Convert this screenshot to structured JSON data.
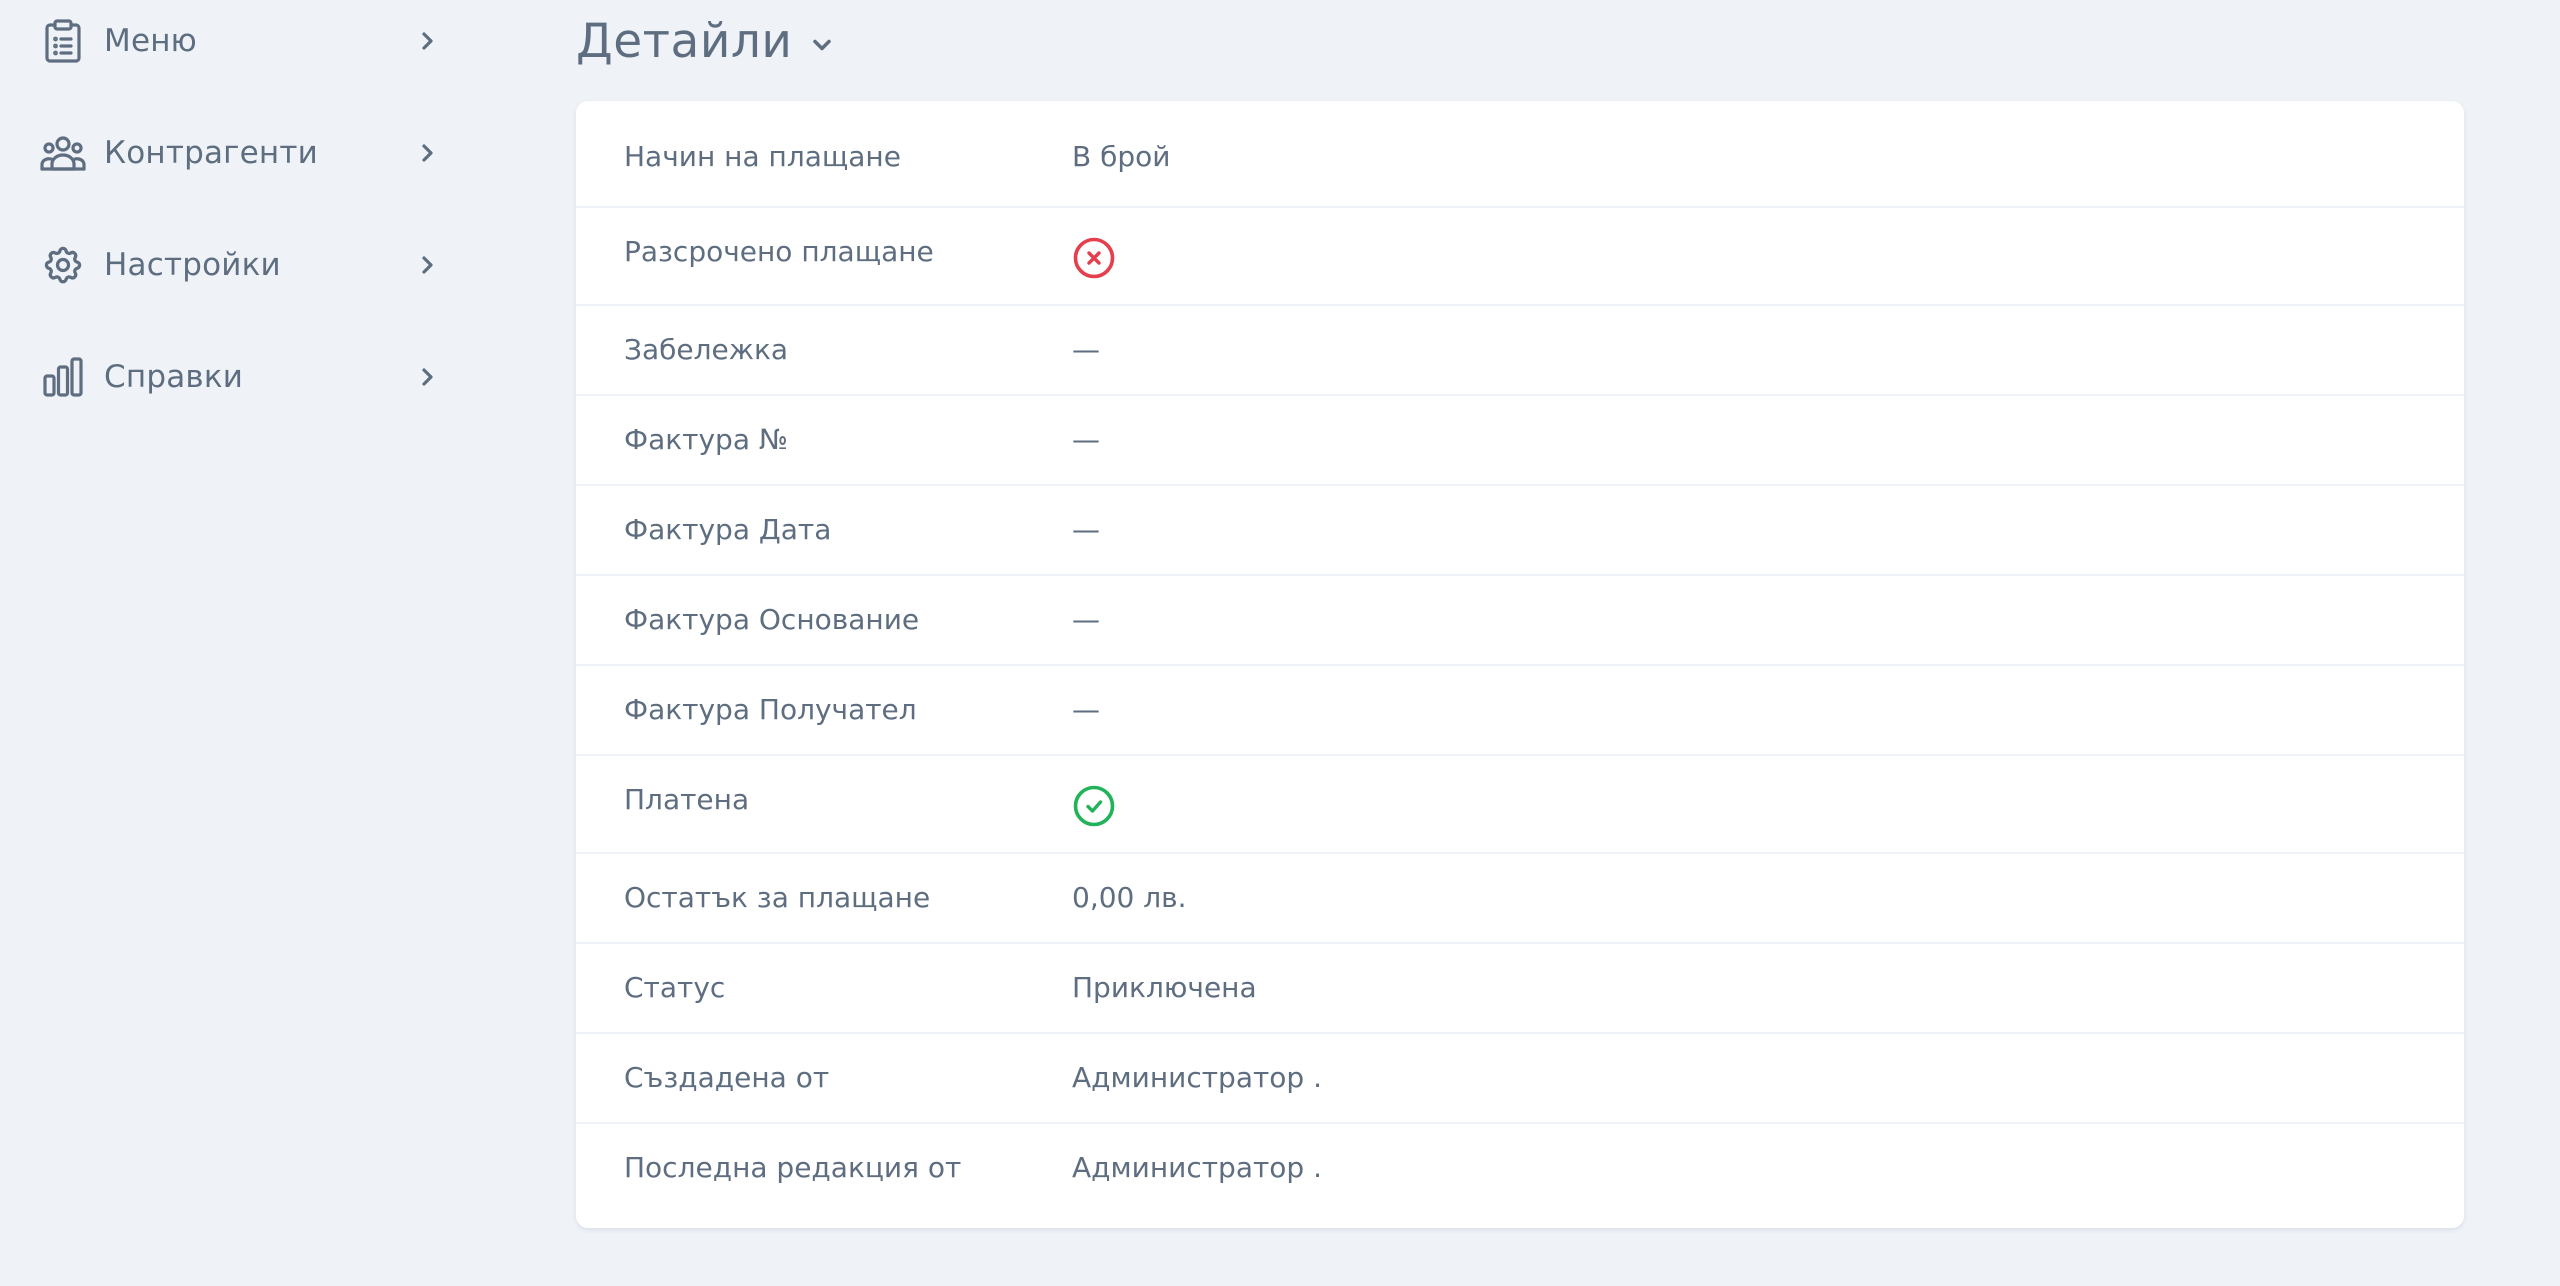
{
  "sidebar": {
    "items": [
      {
        "label": "Меню",
        "icon": "clipboard-list-icon"
      },
      {
        "label": "Контрагенти",
        "icon": "users-icon"
      },
      {
        "label": "Настройки",
        "icon": "gear-icon"
      },
      {
        "label": "Справки",
        "icon": "bar-chart-icon"
      }
    ]
  },
  "header": {
    "title": "Детайли"
  },
  "details": [
    {
      "label": "Начин на плащане",
      "value": "В брой"
    },
    {
      "label": "Разсрочено плащане",
      "icon": "x-circle-icon",
      "status": false
    },
    {
      "label": "Забележка",
      "value": "—"
    },
    {
      "label": "Фактура №",
      "value": "—"
    },
    {
      "label": "Фактура Дата",
      "value": "—"
    },
    {
      "label": "Фактура Основание",
      "value": "—"
    },
    {
      "label": "Фактура Получател",
      "value": "—"
    },
    {
      "label": "Платена",
      "icon": "check-circle-icon",
      "status": true
    },
    {
      "label": "Остатък за плащане",
      "value": "0,00 лв."
    },
    {
      "label": "Статус",
      "value": "Приключена"
    },
    {
      "label": "Създадена от",
      "value": "Администратор ."
    },
    {
      "label": "Последна редакция от",
      "value": "Администратор ."
    }
  ],
  "colors": {
    "background": "#eff3f8",
    "card": "#ffffff",
    "text": "#5e6e80",
    "negative": "#e53e4d",
    "positive": "#22b35a"
  }
}
